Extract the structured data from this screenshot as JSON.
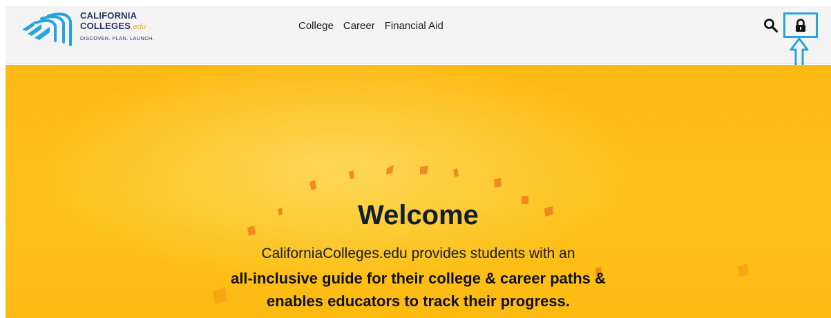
{
  "logo": {
    "line1": "CALIFORNIA",
    "line2": "COLLEGES",
    "line2_suffix": ".edu",
    "tagline": "DISCOVER. PLAN. LAUNCH.",
    "brand_color": "#1f3864",
    "accent_color": "#29a3dd",
    "edu_color": "#f5a623"
  },
  "nav": {
    "items": [
      {
        "label": "College"
      },
      {
        "label": "Career"
      },
      {
        "label": "Financial Aid"
      }
    ]
  },
  "header_actions": {
    "search_icon": "search-icon",
    "lock_icon": "lock-icon",
    "highlight_color": "#29a3dd"
  },
  "hero": {
    "title": "Welcome",
    "intro": "CaliforniaColleges.edu provides students with an",
    "highlight_line1": "all-inclusive guide for their college & career paths &",
    "highlight_line2": "enables educators to track their progress.",
    "background_color": "#fdb913"
  }
}
